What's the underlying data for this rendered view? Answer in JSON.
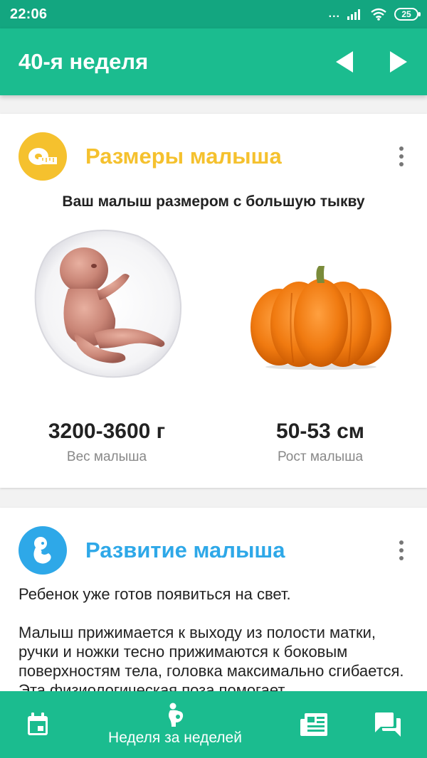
{
  "status_bar": {
    "time": "22:06",
    "battery": "25",
    "signal_dots": "..."
  },
  "app_bar": {
    "title": "40-я неделя",
    "prev_icon": "arrow-left-icon",
    "next_icon": "arrow-right-icon"
  },
  "sizes_card": {
    "title": "Размеры малыша",
    "title_color": "#f5c12e",
    "icon": "measuring-tape-icon",
    "subtitle": "Ваш малыш размером с большую тыкву",
    "weight_value": "3200-3600 г",
    "weight_label": "Вес малыша",
    "height_value": "50-53 см",
    "height_label": "Рост малыша"
  },
  "dev_card": {
    "title": "Развитие малыша",
    "title_color": "#2ea8e8",
    "icon": "fetus-icon",
    "paragraphs": [
      "Ребенок уже готов появиться на свет.",
      "Малыш прижимается к выходу из полости матки, ручки и ножки тесно прижимаются к боковым поверхностям тела, головка максимально сгибается. Эта физиологическая поза помогает"
    ]
  },
  "bottom_nav": {
    "items": [
      {
        "icon": "calendar-icon",
        "label": ""
      },
      {
        "icon": "pregnant-icon",
        "label": "Неделя за неделей"
      },
      {
        "icon": "articles-icon",
        "label": ""
      },
      {
        "icon": "chat-icon",
        "label": ""
      }
    ]
  },
  "colors": {
    "primary": "#1bbc8f",
    "primary_dark": "#13a680",
    "yellow": "#f5c12e",
    "blue": "#2ea8e8"
  }
}
